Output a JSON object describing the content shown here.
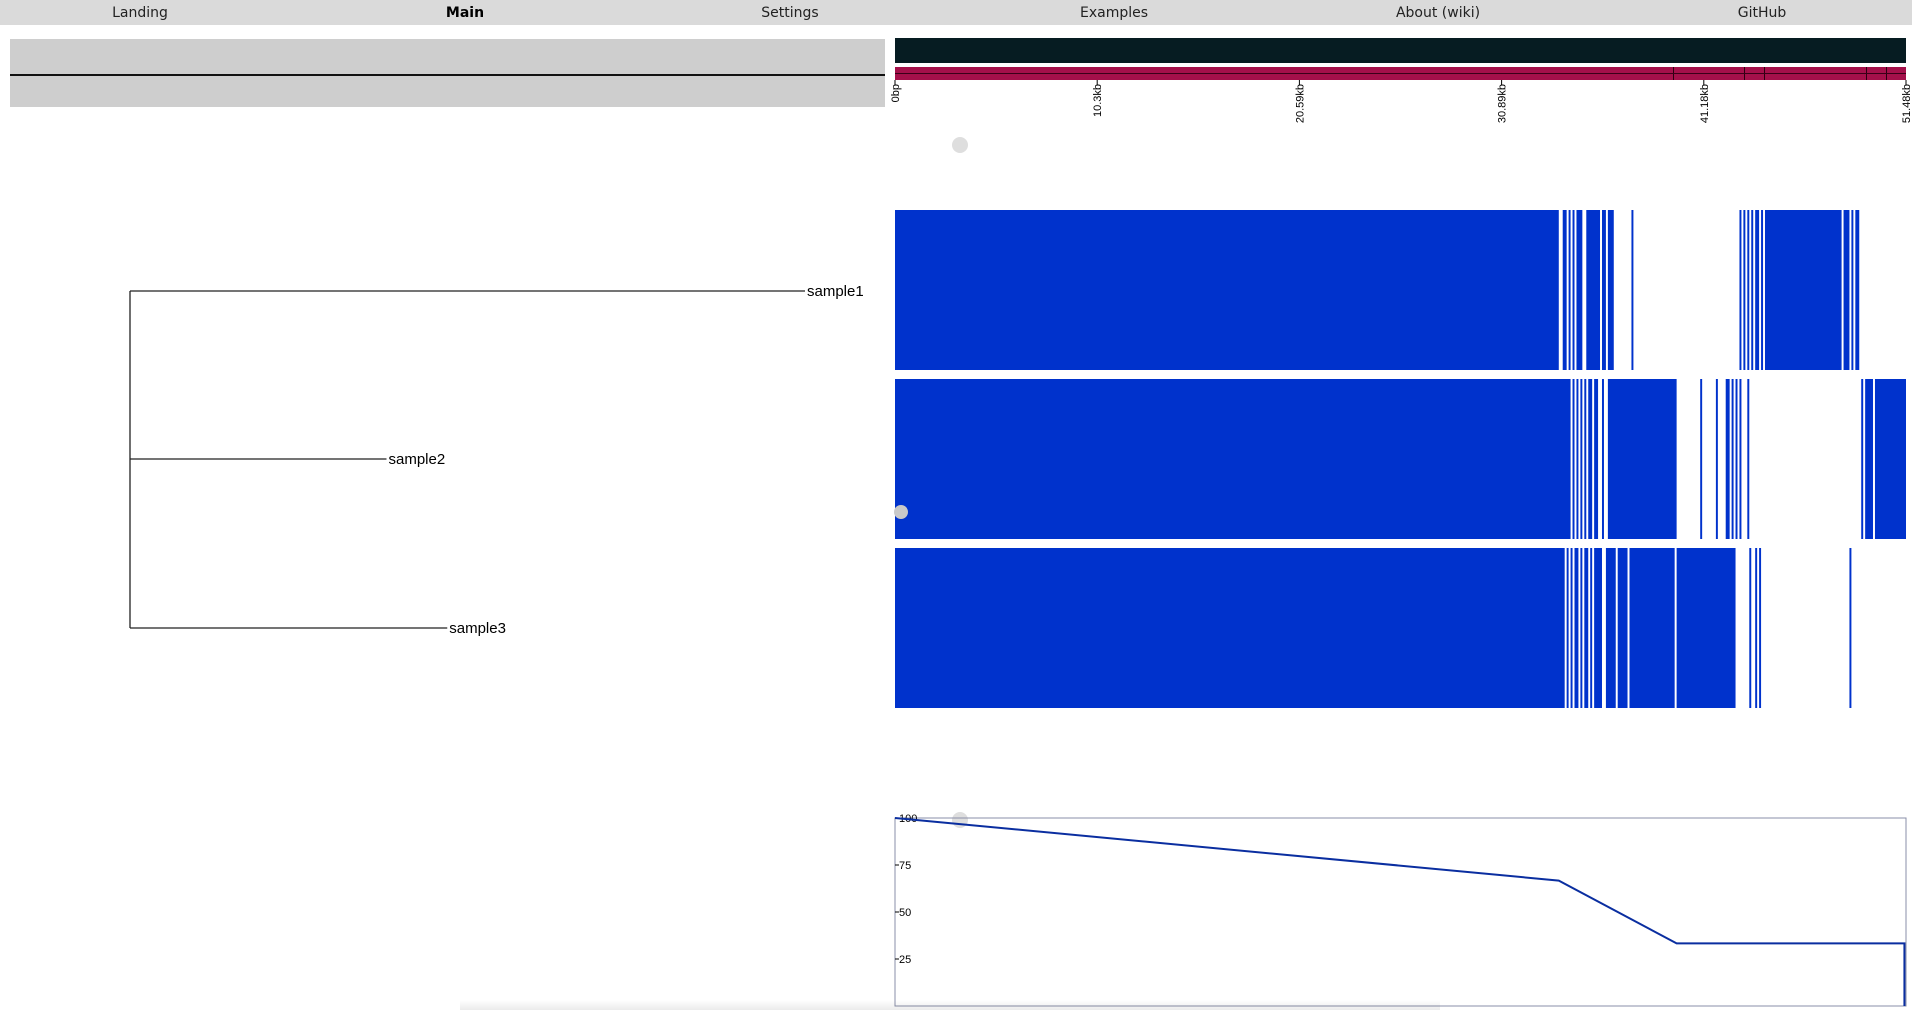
{
  "nav": {
    "items": [
      {
        "label": "Landing",
        "active": false
      },
      {
        "label": "Main",
        "active": true
      },
      {
        "label": "Settings",
        "active": false
      },
      {
        "label": "Examples",
        "active": false
      },
      {
        "label": "About (wiki)",
        "active": false
      },
      {
        "label": "GitHub",
        "active": false
      }
    ]
  },
  "colors": {
    "nav_bg": "#dadada",
    "control_bar": "#cecece",
    "ruler_bar": "#061c22",
    "genome_strip": "#a4104a",
    "coverage_fill": "#0032cc",
    "line_color": "#0a2ea0",
    "handle": "#dedede"
  },
  "ruler": {
    "ticks": [
      "0bp",
      "10.3kb",
      "20.59kb",
      "30.89kb",
      "41.18kb",
      "51.48kb"
    ]
  },
  "tree": {
    "leaves": [
      {
        "label": "sample1",
        "relative_length": 1.0
      },
      {
        "label": "sample2",
        "relative_length": 0.38
      },
      {
        "label": "sample3",
        "relative_length": 0.47
      }
    ]
  },
  "tracks": [
    {
      "name": "sample1",
      "segments_kb": [
        [
          0,
          33.8
        ],
        [
          34.0,
          34.2
        ],
        [
          34.3,
          34.4
        ],
        [
          34.5,
          34.6
        ],
        [
          34.7,
          35.0
        ],
        [
          35.2,
          35.9
        ],
        [
          36.0,
          36.2
        ],
        [
          36.3,
          36.6
        ],
        [
          37.5,
          37.6
        ],
        [
          43.0,
          43.1
        ],
        [
          43.2,
          43.3
        ],
        [
          43.4,
          43.5
        ],
        [
          43.6,
          43.7
        ],
        [
          43.8,
          44.0
        ],
        [
          44.1,
          44.2
        ],
        [
          44.3,
          48.2
        ],
        [
          48.3,
          48.6
        ],
        [
          48.7,
          48.8
        ],
        [
          48.9,
          49.1
        ]
      ]
    },
    {
      "name": "sample2",
      "segments_kb": [
        [
          0,
          34.4
        ],
        [
          34.5,
          34.6
        ],
        [
          34.7,
          34.8
        ],
        [
          34.9,
          35.0
        ],
        [
          35.1,
          35.2
        ],
        [
          35.3,
          35.5
        ],
        [
          35.6,
          35.8
        ],
        [
          36.0,
          36.1
        ],
        [
          36.3,
          39.8
        ],
        [
          41.0,
          41.1
        ],
        [
          41.8,
          41.9
        ],
        [
          42.3,
          42.5
        ],
        [
          42.6,
          42.7
        ],
        [
          42.8,
          42.9
        ],
        [
          43.0,
          43.1
        ],
        [
          43.4,
          43.5
        ],
        [
          49.2,
          49.3
        ],
        [
          49.4,
          49.8
        ],
        [
          49.9,
          51.48
        ]
      ]
    },
    {
      "name": "sample3",
      "segments_kb": [
        [
          0,
          34.1
        ],
        [
          34.2,
          34.3
        ],
        [
          34.4,
          34.5
        ],
        [
          34.6,
          34.8
        ],
        [
          34.9,
          35.0
        ],
        [
          35.1,
          35.3
        ],
        [
          35.4,
          35.5
        ],
        [
          35.6,
          36.0
        ],
        [
          36.2,
          36.7
        ],
        [
          36.8,
          37.3
        ],
        [
          37.4,
          39.7
        ],
        [
          39.8,
          42.8
        ],
        [
          43.5,
          43.6
        ],
        [
          43.8,
          43.9
        ],
        [
          44.0,
          44.1
        ],
        [
          48.6,
          48.7
        ]
      ]
    }
  ],
  "chart_data": {
    "type": "line",
    "title": "",
    "xlabel": "",
    "ylabel": "",
    "ylim": [
      0,
      100
    ],
    "yticks": [
      "100",
      "75",
      "50",
      "25"
    ],
    "xlim": [
      0,
      51.48
    ],
    "series": [
      {
        "x": [
          0,
          33.8,
          33.8,
          39.8,
          39.8,
          51.4,
          51.4
        ],
        "y": [
          100,
          66.7,
          66.7,
          33.3,
          33.3,
          33.3,
          0
        ]
      }
    ]
  }
}
